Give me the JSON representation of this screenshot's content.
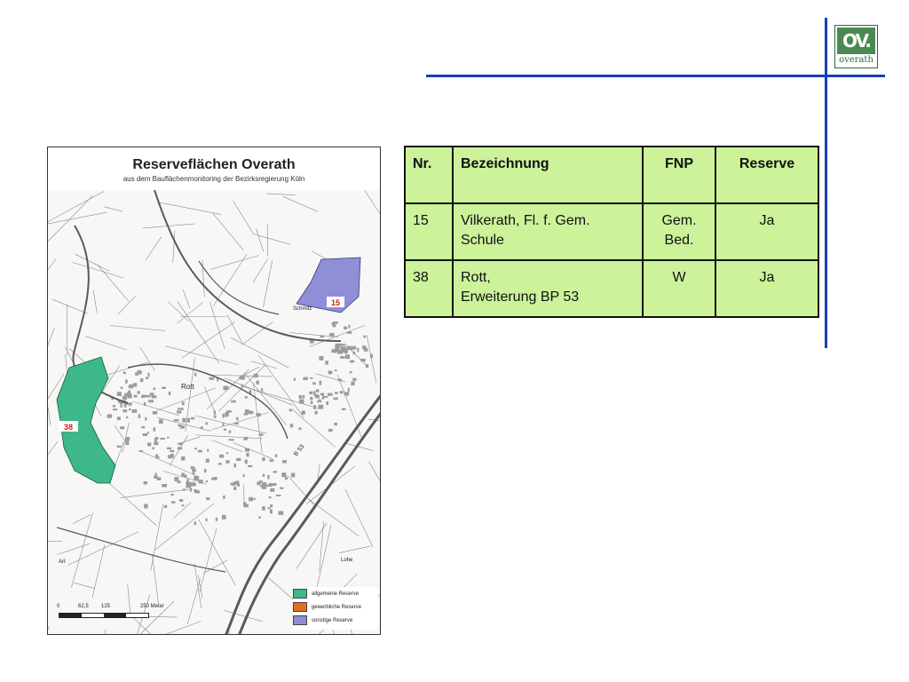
{
  "logo": {
    "mark": "OV.",
    "word": "overath"
  },
  "map": {
    "title": "Reserveflächen Overath",
    "subtitle": "aus dem Bauflächenmonitoring der Bezirksregierung Köln",
    "place_labels": {
      "rott": "Rott",
      "schmitz": "Schmitz",
      "b53": "B 53",
      "art": "Art",
      "grube": "Grube Berzelius",
      "misc": "Lohe"
    },
    "areas": [
      {
        "id": "15",
        "label": "15",
        "category": "sonstige Reserve"
      },
      {
        "id": "38",
        "label": "38",
        "category": "allgemeine Reserve"
      }
    ],
    "legend": [
      {
        "label": "allgemeine Reserve",
        "color": "#3db88a"
      },
      {
        "label": "gewerbliche Reserve",
        "color": "#e0701e"
      },
      {
        "label": "sonstige Reserve",
        "color": "#8f8ed6"
      }
    ],
    "scale": {
      "ticks": [
        "0",
        "62,5",
        "125",
        "250 Meter"
      ]
    }
  },
  "table": {
    "headers": [
      "Nr.",
      "Bezeichnung",
      "FNP",
      "Reserve"
    ],
    "rows": [
      {
        "nr": "15",
        "bez_line1": "Vilkerath, Fl. f. Gem.",
        "bez_line2": "Schule",
        "fnp_line1": "Gem.",
        "fnp_line2": "Bed.",
        "reserve": "Ja"
      },
      {
        "nr": "38",
        "bez_line1": "Rott,",
        "bez_line2": "Erweiterung BP 53",
        "fnp_line1": "W",
        "fnp_line2": "",
        "reserve": "Ja"
      }
    ]
  },
  "colors": {
    "rule": "#1a3fb0",
    "table_bg": "#ccf29a",
    "area_allgemein": "#3db88a",
    "area_sonstige": "#8f8ed6",
    "area_label": "#d42020"
  }
}
